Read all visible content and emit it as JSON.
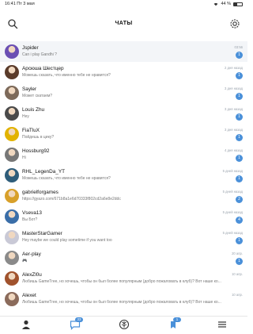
{
  "status": {
    "time": "16:41",
    "date": "Пт 3 мая",
    "battery": "44 %",
    "battery_level": 0.44
  },
  "header": {
    "title": "ЧАТЫ"
  },
  "chats": [
    {
      "name": "Jspider",
      "message": "Can i play Gandhi ?",
      "time": "03:56",
      "badge": "1",
      "avatar_color": "#6b4fb3",
      "alt": true
    },
    {
      "name": "Арсюша Шестцер",
      "message": "Можешь сказать, что именно тебе не нравится?",
      "time": "2 дня назад",
      "badge": "1",
      "avatar_color": "#5a3b2a",
      "alt": false
    },
    {
      "name": "Sayler",
      "message": "Может скатаем?",
      "time": "3 дня назад",
      "badge": "1",
      "avatar_color": "#7d6a5a",
      "alt": false
    },
    {
      "name": "Louis Zhu",
      "message": "Hey",
      "time": "3 дня назад",
      "badge": "1",
      "avatar_color": "#4a4a4a",
      "alt": false
    },
    {
      "name": "FiaTluX",
      "message": "Пойдешь в цику?",
      "time": "3 дня назад",
      "badge": "1",
      "avatar_color": "#e2b300",
      "alt": false
    },
    {
      "name": "Hossburg92",
      "message": "Hi",
      "time": "4 дня назад",
      "badge": "1",
      "avatar_color": "#777777",
      "alt": false
    },
    {
      "name": "RHL_LegenDa_YT",
      "message": "Можешь сказать, что именно тебе не нравится?",
      "time": "5 дней назад",
      "badge": "1",
      "avatar_color": "#2f5d7a",
      "alt": false
    },
    {
      "name": "gabrielforgames",
      "message": "https://gyazo.com/671b8a1e6d70333f802cd2a6e8e2ddc",
      "time": "5 дней назад",
      "badge": "2",
      "avatar_color": "#d8a02a",
      "alt": false
    },
    {
      "name": "Vseva13",
      "message": "Вы Бот?",
      "time": "5 дней назад",
      "badge": "4",
      "avatar_color": "#3a6ea8",
      "alt": false
    },
    {
      "name": "MasterStarGamer",
      "message": "Hey maybe we could play sometime if you want too",
      "time": "5 дней назад",
      "badge": "1",
      "avatar_color": "#c9c9d6",
      "alt": false
    },
    {
      "name": "Aer-play",
      "message": "🎮",
      "time": "20 апр.",
      "badge": "1",
      "avatar_color": "#8a8a8a",
      "alt": false
    },
    {
      "name": "AlexZl0u",
      "message": "Любишь GameTree, но хочешь, чтобы он был более популярным (добро пожаловать в клуб)? Вот наше ко...",
      "time": "10 апр.",
      "badge": "",
      "avatar_color": "#a0522d",
      "alt": false
    },
    {
      "name": "Alexet",
      "message": "Любишь GameTree, но хочешь, чтобы он был более популярным (добро пожаловать в клуб)? Вот наше ко...",
      "time": "10 апр.",
      "badge": "",
      "avatar_color": "#8b6b5b",
      "alt": false
    }
  ],
  "tabs": [
    {
      "name": "tab-profile",
      "icon": "person-icon",
      "badge": ""
    },
    {
      "name": "tab-chats",
      "icon": "chat-bubble-icon",
      "badge": "33"
    },
    {
      "name": "tab-games",
      "icon": "tree-icon",
      "badge": ""
    },
    {
      "name": "tab-notifications",
      "icon": "notification-icon",
      "badge": "1"
    },
    {
      "name": "tab-menu",
      "icon": "menu-icon",
      "badge": ""
    }
  ]
}
